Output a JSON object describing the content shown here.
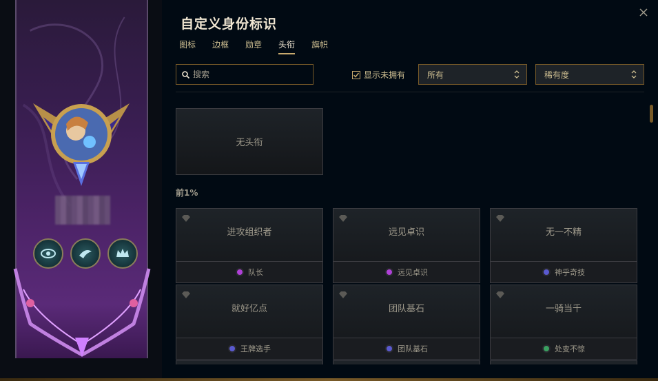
{
  "dialog": {
    "title": "自定义身份标识",
    "close_icon": "close-icon"
  },
  "tabs": [
    {
      "label": "图标",
      "active": false
    },
    {
      "label": "边框",
      "active": false
    },
    {
      "label": "勋章",
      "active": false
    },
    {
      "label": "头衔",
      "active": true
    },
    {
      "label": "旗帜",
      "active": false
    }
  ],
  "filters": {
    "search_placeholder": "搜索",
    "show_unowned_label": "显示未拥有",
    "show_unowned_checked": true,
    "ownership_select": "所有",
    "rarity_select": "稀有度"
  },
  "none_title": "无头衔",
  "section": {
    "label": "前1%"
  },
  "titles": [
    {
      "name": "进攻组织者",
      "source": "队长",
      "dot_color": "#b040d8"
    },
    {
      "name": "远见卓识",
      "source": "远见卓识",
      "dot_color": "#b040d8"
    },
    {
      "name": "无一不精",
      "source": "神乎奇技",
      "dot_color": "#5a5ad0"
    },
    {
      "name": "就好亿点",
      "source": "王牌选手",
      "dot_color": "#5a5ad0"
    },
    {
      "name": "团队基石",
      "source": "团队基石",
      "dot_color": "#5a5ad0"
    },
    {
      "name": "一骑当千",
      "source": "处变不惊",
      "dot_color": "#3aa060"
    }
  ],
  "colors": {
    "accent_gold": "#c8aa6e",
    "background": "#010a13"
  }
}
